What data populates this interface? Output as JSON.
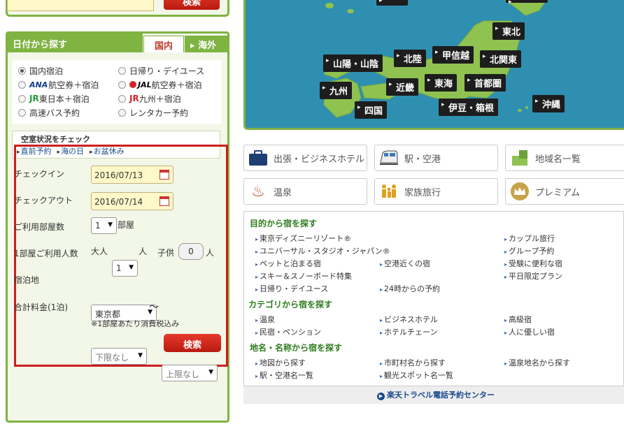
{
  "top_search": {
    "button": "検索"
  },
  "date_search": {
    "title": "日付から探す",
    "tab_domestic": "国内",
    "tab_overseas": "海外",
    "types": [
      {
        "label": "国内宿泊",
        "checked": true
      },
      {
        "label": "日帰り・デイユース",
        "checked": false
      },
      {
        "logo": "ANA",
        "label": "航空券＋宿泊",
        "checked": false
      },
      {
        "logo": "JAL",
        "label": "航空券＋宿泊",
        "checked": false
      },
      {
        "logo": "JR",
        "label": "東日本＋宿泊",
        "checked": false
      },
      {
        "logo": "JR",
        "label": "九州＋宿泊",
        "checked": false
      },
      {
        "label": "高速バス予約",
        "checked": false
      },
      {
        "label": "レンタカー予約",
        "checked": false
      }
    ],
    "vacancy_title": "空室状況をチェック",
    "quick_links": [
      "直前予約",
      "海の日",
      "お盆休み"
    ],
    "form": {
      "checkin_label": "チェックイン",
      "checkin_value": "2016/07/13",
      "checkout_label": "チェックアウト",
      "checkout_value": "2016/07/14",
      "rooms_label": "ご利用部屋数",
      "rooms_value": "1",
      "rooms_unit": "部屋",
      "guests_label": "1部屋ご利用人数",
      "adult_label": "大人",
      "adult_value": "1",
      "adult_unit": "人",
      "child_label": "子供",
      "child_value": "0",
      "child_unit": "人",
      "location_label": "宿泊地",
      "location_value": "東京都",
      "price_label": "合計料金(1泊)",
      "price_min": "下限なし",
      "price_tilde": "〜",
      "price_max": "上限なし",
      "price_note": "※1部屋あたり消費税込み",
      "search_button": "検索"
    }
  },
  "map": {
    "regions": [
      "東北",
      "北陸",
      "甲信越",
      "北関東",
      "山陽・山陰",
      "九州",
      "近畿",
      "東海",
      "首都圏",
      "四国",
      "伊豆・箱根",
      "沖縄"
    ]
  },
  "categories": [
    "出張・ビジネスホテル",
    "駅・空港",
    "地域名一覧",
    "温泉",
    "家族旅行",
    "プレミアム"
  ],
  "purpose": {
    "title": "目的から宿を探す",
    "col1": [
      "東京ディズニーリゾート®",
      "ユニバーサル・スタジオ・ジャパン®",
      "ペットと泊まる宿",
      "スキー＆スノーボード特集",
      "日帰り・デイユース"
    ],
    "col2": [
      "空港近くの宿",
      "24時からの予約"
    ],
    "col3": [
      "カップル旅行",
      "グループ予約",
      "受験に便利な宿",
      "平日限定プラン"
    ]
  },
  "category_search": {
    "title": "カテゴリから宿を探す",
    "col1": [
      "温泉",
      "民宿・ペンション"
    ],
    "col2": [
      "ビジネスホテル",
      "ホテルチェーン"
    ],
    "col3": [
      "高級宿",
      "人に優しい宿"
    ]
  },
  "place_search": {
    "title": "地名・名称から宿を探す",
    "col1": [
      "地図から探す",
      "駅・空港名一覧"
    ],
    "col2": [
      "市町村名から探す",
      "観光スポット名一覧"
    ],
    "col3": [
      "温泉地名から探す"
    ]
  },
  "call_center": "楽天トラベル電話予約センター",
  "colors": {
    "green": "#7fb342",
    "red_button": "#cc2a1e",
    "highlight_frame": "#cc1e1e",
    "sea": "#2f8fb0"
  }
}
